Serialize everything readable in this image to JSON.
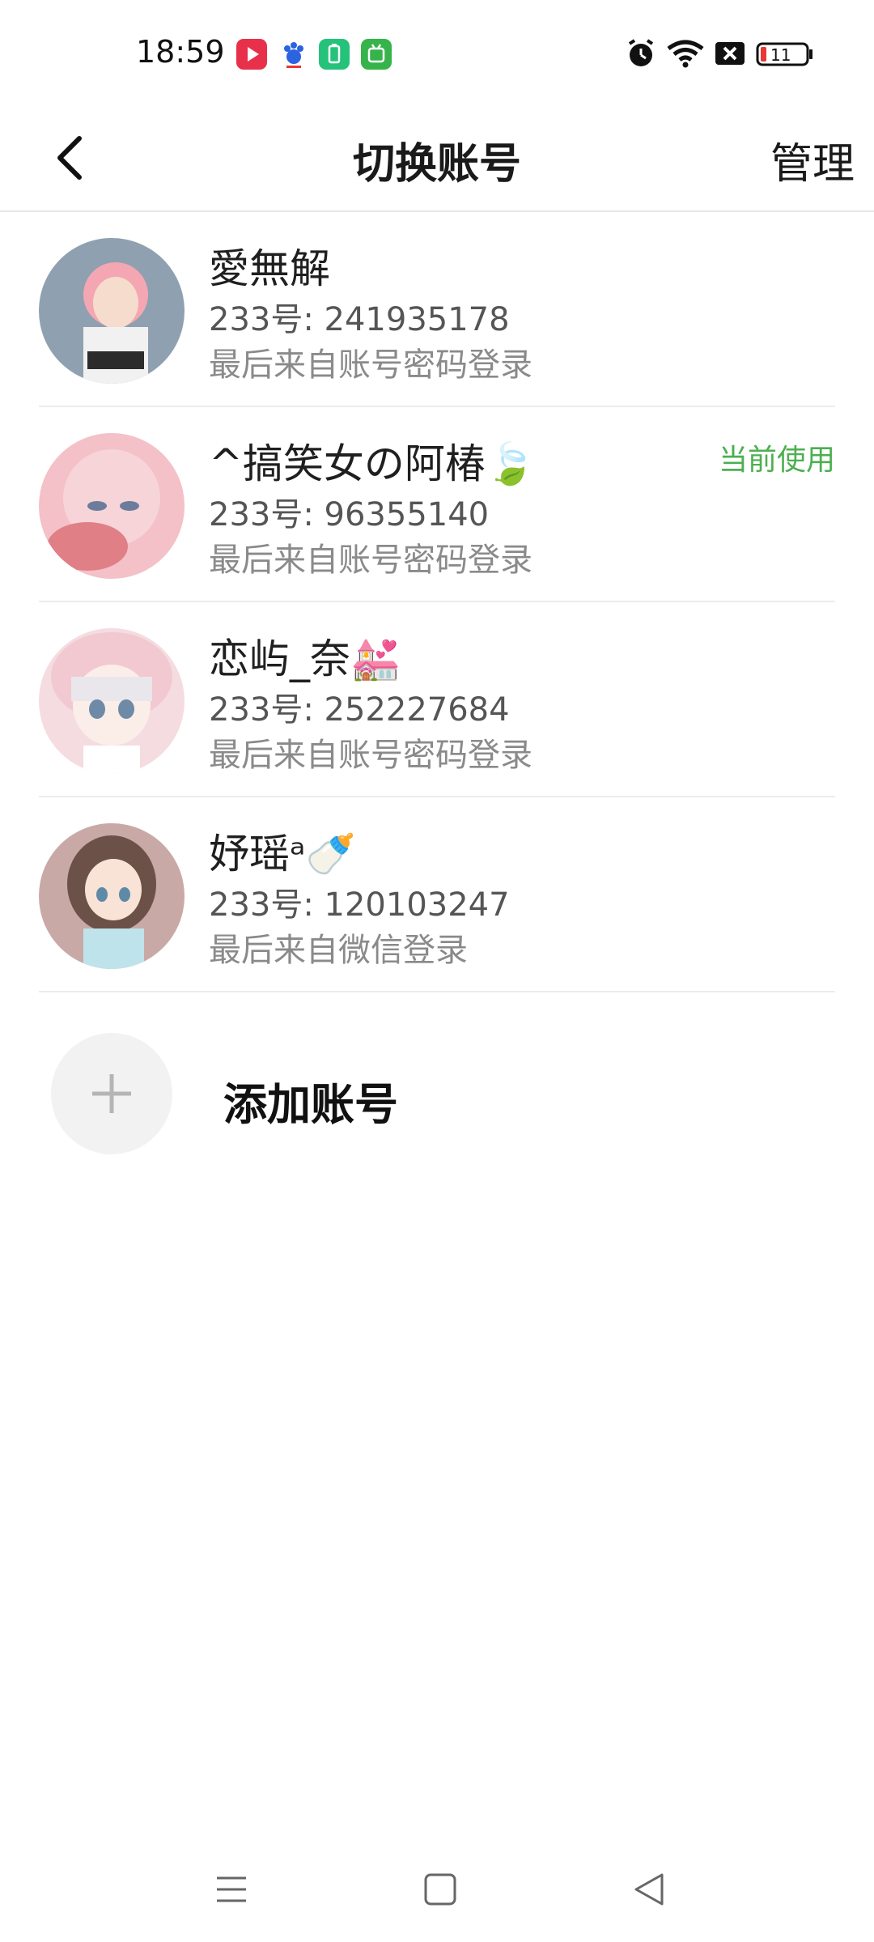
{
  "status_bar": {
    "time": "18:59",
    "app_icons": [
      "video-app-icon",
      "baidu-icon",
      "battery-app-icon",
      "green-app-icon"
    ],
    "system_icons": [
      "alarm-icon",
      "wifi-icon",
      "close-box-icon",
      "battery-icon"
    ],
    "battery_level": "11"
  },
  "header": {
    "title": "切换账号",
    "manage_label": "管理"
  },
  "accounts": [
    {
      "name": "愛無解",
      "id_text": "233号: 241935178",
      "login_text": "最后来自账号密码登录",
      "badge": ""
    },
    {
      "name": "^搞笑女の阿椿🍃",
      "id_text": "233号: 96355140",
      "login_text": "最后来自账号密码登录",
      "badge": "当前使用"
    },
    {
      "name": "恋屿_奈💒",
      "id_text": "233号: 252227684",
      "login_text": "最后来自账号密码登录",
      "badge": ""
    },
    {
      "name": "妤瑶ᵃ🍼",
      "id_text": "233号: 120103247",
      "login_text": "最后来自微信登录",
      "badge": ""
    }
  ],
  "add_account": {
    "label": "添加账号"
  },
  "colors": {
    "accent_green": "#4caf50",
    "divider": "#ececec"
  }
}
